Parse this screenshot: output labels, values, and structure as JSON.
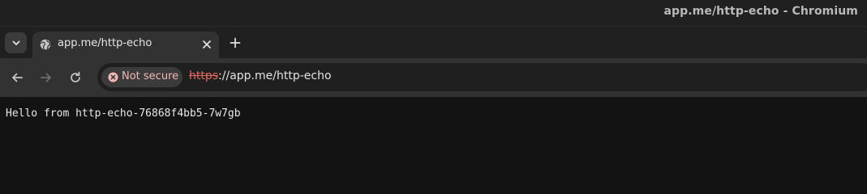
{
  "window": {
    "title": "app.me/http-echo - Chromium"
  },
  "tabstrip": {
    "search_icon": "chevron-down-icon",
    "tabs": [
      {
        "title": "app.me/http-echo",
        "favicon": "globe-icon",
        "active": true
      }
    ],
    "new_tab_icon": "plus-icon"
  },
  "toolbar": {
    "back_icon": "arrow-left-icon",
    "forward_icon": "arrow-right-icon",
    "reload_icon": "reload-icon",
    "security": {
      "label": "Not secure",
      "icon": "warning-circle-icon",
      "color": "#f2b8b5"
    },
    "url": {
      "scheme": "https",
      "separator": "://",
      "rest": "app.me/http-echo"
    }
  },
  "page": {
    "text": "Hello from http-echo-76868f4bb5-7w7gb"
  }
}
